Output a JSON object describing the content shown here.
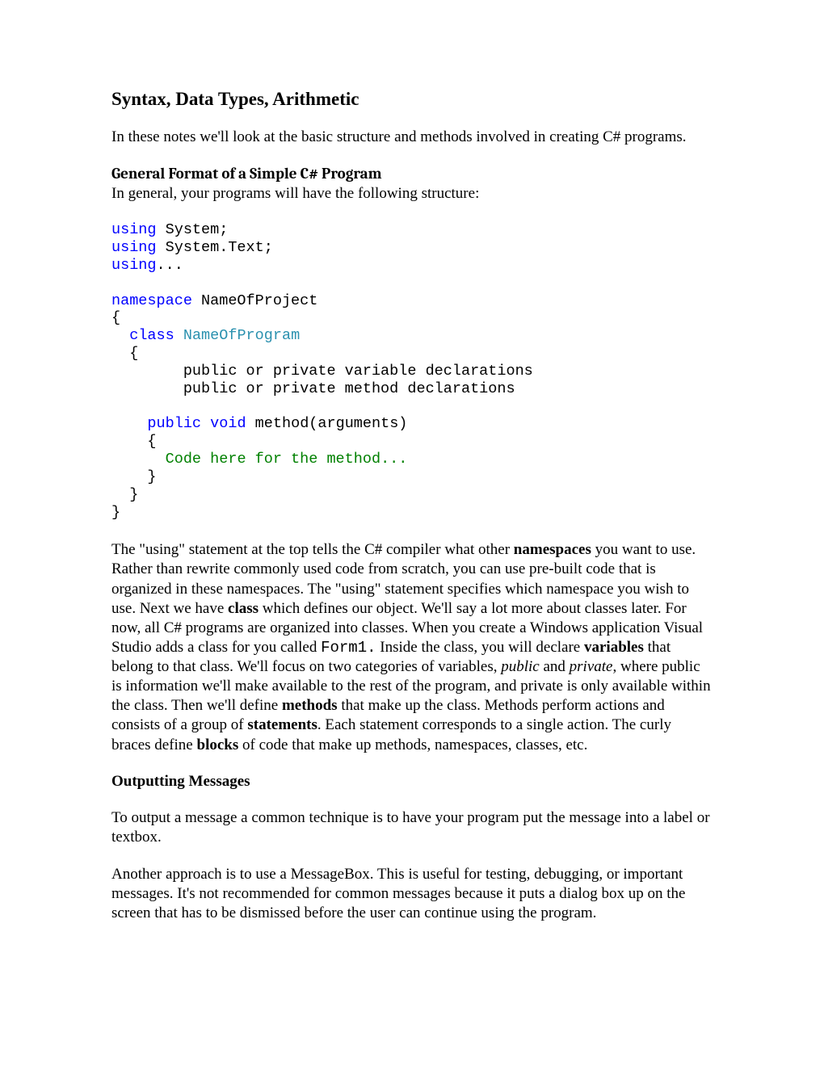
{
  "title": "Syntax, Data Types, Arithmetic",
  "intro": "In these notes we'll look at the basic structure and methods involved in creating C# programs.",
  "h2a": "General Format of a Simple C# Program",
  "intro2": "In general, your programs will have the following structure:",
  "code": {
    "using1_kw": "using",
    "using1_rest": " System;",
    "using2_kw": "using",
    "using2_rest": " System.Text;",
    "using3_kw": "using",
    "using3_rest": "...",
    "ns_kw": "namespace",
    "ns_rest": " NameOfProject",
    "brace_open": "{",
    "class_indent": "  ",
    "class_kw": "class",
    "class_space": " ",
    "class_name": "NameOfProgram",
    "class_brace": "  {",
    "decl1": "        public or private variable declarations",
    "decl2": "        public or private method declarations",
    "blank": "",
    "method_indent": "    ",
    "method_kw1": "public",
    "method_space1": " ",
    "method_kw2": "void",
    "method_rest": " method(arguments)",
    "method_brace_open": "    {",
    "method_body_indent": "      ",
    "method_body": "Code here for the method...",
    "method_brace_close": "    }",
    "class_brace_close": "  }",
    "brace_close": "}"
  },
  "para2": {
    "t1": "The \"using\" statement at the top tells the C# compiler what other ",
    "b1": "namespaces",
    "t2": " you want to use.  Rather than rewrite commonly used code from scratch, you can use pre-built code that is organized in these namespaces.  The \"using\" statement specifies which namespace you wish to use.  Next we have ",
    "b2": "class",
    "t3": " which defines our object.  We'll say a lot more about classes later.  For now, all C# programs are organized into classes.  When you create a Windows application Visual Studio adds a class for you called ",
    "code1": "Form1.",
    "t4": "  Inside the class, you will declare ",
    "b3": "variables",
    "t5": " that belong to that class.  We'll focus on two categories of variables, ",
    "i1": "public",
    "t6": " and ",
    "i2": "private",
    "t7": ", where public is information we'll make available to the rest of the program, and private is only available within the class.  Then we'll define ",
    "b4": "methods",
    "t8": " that make up the class.  Methods perform actions and consists of a group of ",
    "b5": "statements",
    "t9": ".  Each statement corresponds to a single action.  The curly braces define ",
    "b6": "blocks",
    "t10": " of code that make up methods, namespaces, classes, etc."
  },
  "h2b": "Outputting Messages",
  "para3": "To output a message a common technique is to have your program put the message into a label or textbox.",
  "para4": "Another approach is to use a MessageBox.  This is useful for testing, debugging, or important messages.  It's not recommended for common messages because it puts a dialog box up on the screen that has to be dismissed before the user can continue using the program."
}
